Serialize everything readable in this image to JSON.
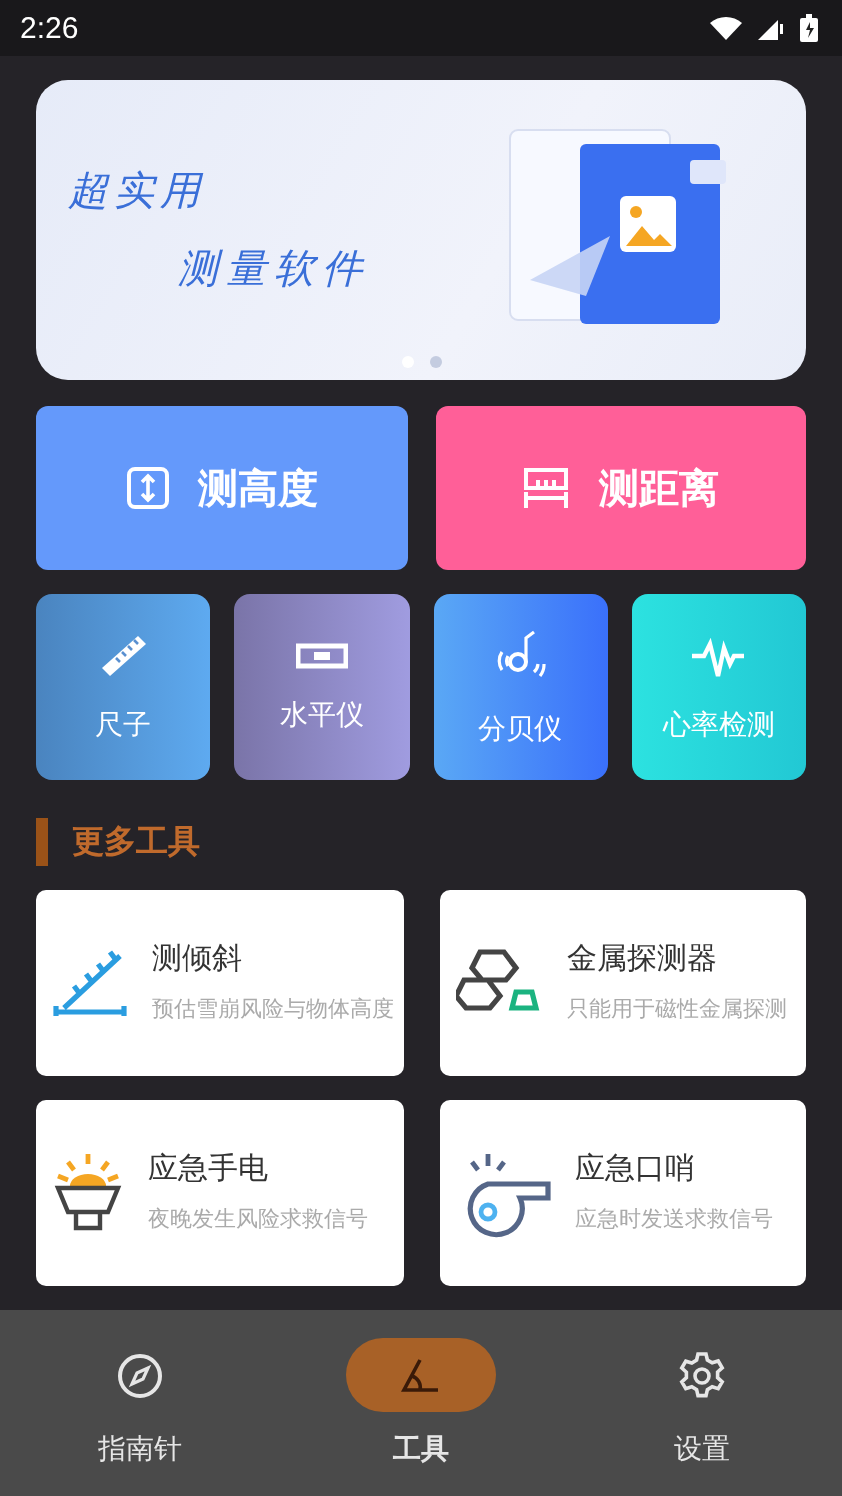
{
  "status_bar": {
    "time": "2:26"
  },
  "banner": {
    "headline": "超实用",
    "subline": "测量软件",
    "dots": [
      {
        "selected": true
      },
      {
        "selected": false
      }
    ]
  },
  "main_tools": [
    {
      "kind": "height",
      "label": "测高度"
    },
    {
      "kind": "distance",
      "label": "测距离"
    }
  ],
  "quick_tools": [
    {
      "kind": "ruler",
      "label": "尺子"
    },
    {
      "kind": "level",
      "label": "水平仪"
    },
    {
      "kind": "decibel",
      "label": "分贝仪"
    },
    {
      "kind": "heart",
      "label": "心率检测"
    }
  ],
  "more_tools": {
    "title": "更多工具",
    "items": [
      {
        "kind": "tilt",
        "title": "测倾斜",
        "desc": "预估雪崩风险与物体高度"
      },
      {
        "kind": "metal",
        "title": "金属探测器",
        "desc": "只能用于磁性金属探测"
      },
      {
        "kind": "flashlight",
        "title": "应急手电",
        "desc": "夜晚发生风险求救信号"
      },
      {
        "kind": "whistle",
        "title": "应急口哨",
        "desc": "应急时发送求救信号"
      }
    ]
  },
  "nav": [
    {
      "kind": "compass",
      "label": "指南针",
      "selected": false
    },
    {
      "kind": "tools",
      "label": "工具",
      "selected": true
    },
    {
      "kind": "settings",
      "label": "设置",
      "selected": false
    }
  ]
}
